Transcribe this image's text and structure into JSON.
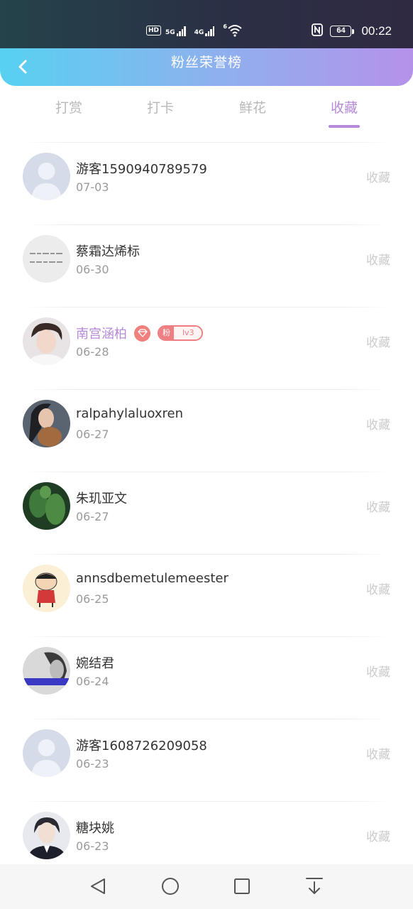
{
  "status_bar": {
    "hd": "HD",
    "net1": "5G",
    "net2": "4G",
    "wifi_tag": "6",
    "battery": "64",
    "time": "00:22"
  },
  "header": {
    "title": "粉丝荣誉榜",
    "back_icon": "chevron-left-icon"
  },
  "tabs": [
    {
      "label": "打赏",
      "active": false
    },
    {
      "label": "打卡",
      "active": false
    },
    {
      "label": "鲜花",
      "active": false
    },
    {
      "label": "收藏",
      "active": true
    }
  ],
  "colors": {
    "accent": "#b68ad8",
    "header_gradient_start": "#57d1f1",
    "header_gradient_end": "#b592ea",
    "badge": "#ef7e83"
  },
  "fans": [
    {
      "name": "游客1590940789579",
      "date": "07-03",
      "action": "收藏",
      "avatar": "default"
    },
    {
      "name": "蔡霜达烯标",
      "date": "06-30",
      "action": "收藏",
      "avatar": "calligraphy"
    },
    {
      "name": "南宫涵柏",
      "date": "06-28",
      "action": "收藏",
      "avatar": "boy",
      "vip": true,
      "badge_label": "粉",
      "badge_level": "lv3"
    },
    {
      "name": "ralpahylaluoxren",
      "date": "06-27",
      "action": "收藏",
      "avatar": "girl-dog"
    },
    {
      "name": "朱玑亚文",
      "date": "06-27",
      "action": "收藏",
      "avatar": "cactus"
    },
    {
      "name": "annsdbemetulemeester",
      "date": "06-25",
      "action": "收藏",
      "avatar": "cartoon"
    },
    {
      "name": "婉结君",
      "date": "06-24",
      "action": "收藏",
      "avatar": "bw-portrait"
    },
    {
      "name": "游客1608726209058",
      "date": "06-23",
      "action": "收藏",
      "avatar": "default"
    },
    {
      "name": "糖块姚",
      "date": "06-23",
      "action": "收藏",
      "avatar": "suit-boy"
    }
  ],
  "nav_bar": [
    "back-triangle-icon",
    "home-circle-icon",
    "recents-square-icon",
    "download-arrow-icon"
  ]
}
